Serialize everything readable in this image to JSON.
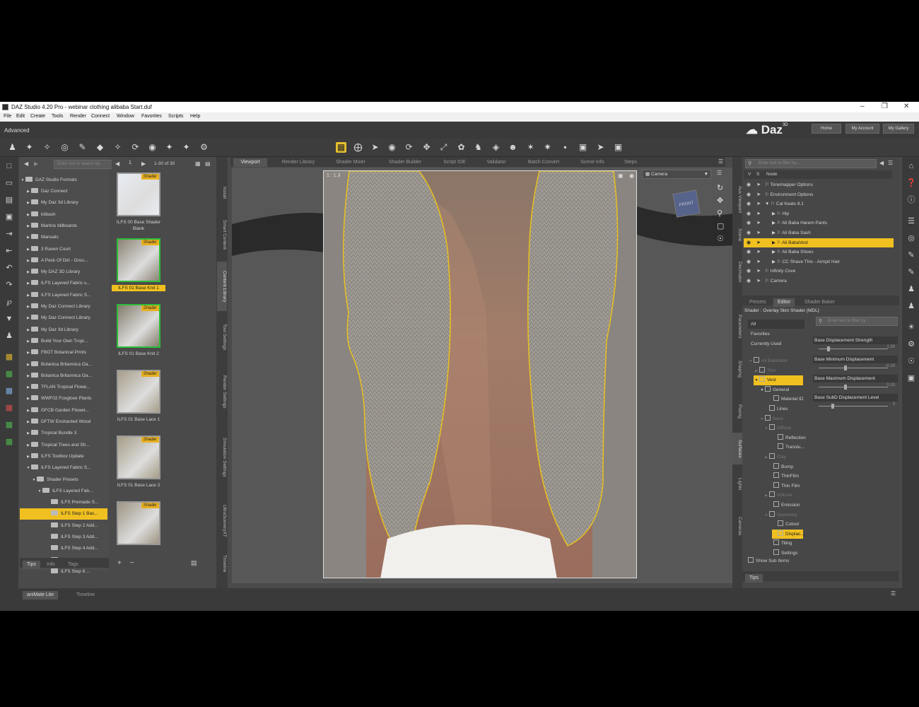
{
  "window": {
    "title": "DAZ Studio 4.20 Pro - webinar clothing alibaba Start.duf"
  },
  "menu": [
    "File",
    "Edit",
    "Create",
    "Tools",
    "Render",
    "Connect",
    "Window",
    "Favorites",
    "Scripts",
    "Help"
  ],
  "layout_label": "Advanced",
  "brand": {
    "logo": "Daz",
    "sup": "3D"
  },
  "nav_buttons": [
    "Home",
    "My Account",
    "My Gallery"
  ],
  "library": {
    "search_placeholder": "Enter text to search by...",
    "root": "DAZ Studio Formats",
    "items": [
      "Daz Connect",
      "My Daz 3d Library",
      "kitbash",
      "Martins billboards",
      "Manuals",
      "3 Raven Court",
      "A Peck Of Dirt - Grou...",
      "My DAZ 3D Library",
      "ILFS Layered Fabric s...",
      "ILFS Layered Fabric S...",
      "My Daz Connect Library",
      "My Daz Connect Library",
      "My Daz 3d Library",
      "Build Your Own Tropi...",
      "FBOT Botanical Prints",
      "Botanica Britannica Oa...",
      "Botanica Britannica Oa...",
      "TFLAN Tropical Flowe...",
      "WWF02 Foxglove Plants",
      "GFCB Garden Flower...",
      "DFTW Enchanted Wood",
      "Tropical Bundle 3",
      "Tropical Trees and Sh...",
      "ILFS Toolbox Update",
      "ILFS Layered Fabric S..."
    ],
    "sub_items": [
      "Shader Presets",
      "ILFS Layered Fab...",
      "ILFS Premade S...",
      "ILFS Step 1 Bas...",
      "ILFS Step 2 Add...",
      "ILFS Step 3 Add...",
      "ILFS Step 4 Add...",
      "ILFS Step 5 Add...",
      "ILFS Step 6 ..."
    ],
    "tabs": [
      "Tips",
      "Info",
      "Tags"
    ]
  },
  "thumbs": {
    "page_number": "1",
    "range": "1-30 of 30",
    "badge": "Shader",
    "items": [
      {
        "label": "ILFS 00 Base Shader Blank"
      },
      {
        "label": "ILFS 01 Base Knit 1"
      },
      {
        "label": "ILFS 01 Base Knit 2"
      },
      {
        "label": "ILFS 01 Base Lace 1"
      },
      {
        "label": "ILFS 01 Base Lace 2"
      },
      {
        "label": ""
      }
    ]
  },
  "side_tabs_left": [
    "Install",
    "Smart Content",
    "Content Library",
    "Tool Settings",
    "Render Settings",
    "Simulation Settings",
    "UltraSceneryXT",
    "Timeline"
  ],
  "viewport": {
    "tabs": [
      "Viewport",
      "Render Library",
      "Shader Mixer",
      "Shader Builder",
      "Script IDE",
      "Validator",
      "Batch Convert",
      "Scene Info",
      "Steps"
    ],
    "ratio": "1 : 1.3",
    "camera": "Camera",
    "cube_label": "FRONT"
  },
  "side_tabs_mid": [
    "Aux Viewport",
    "Scene",
    "Decimator",
    "Parameters",
    "Shaping",
    "Posing",
    "Surfaces",
    "Lights",
    "Cameras"
  ],
  "scene": {
    "filter_placeholder": "Enter text to filter by...",
    "col_v": "V",
    "col_s": "S",
    "col_node": "Node",
    "rows": [
      "Tonemapper Options",
      "Environment Options",
      "Cal Keats 8.1",
      "Hip",
      "Ali Baba Harem Pants",
      "Ali Baba Sash",
      "Ali BabaVest",
      "Ali Baba Shoes",
      "CC Shave This - Armpit Hair",
      "Infinity Cove",
      "Camera"
    ]
  },
  "surfaces": {
    "tabs": [
      "Presets",
      "Editor",
      "Shader Baker"
    ],
    "shader": "Shader : Overlay Skin Shader (MDL)",
    "filters": [
      "All",
      "Favorites",
      "Currently Used"
    ],
    "filter_placeholder": "Enter text to filter by...",
    "tree": [
      "Ali BabaVest",
      "Trim",
      "Vest",
      "General",
      "Material ID",
      "Lines",
      "Base",
      "Diffuse",
      "Reflection",
      "Translu...",
      "Clay",
      "Bump",
      "ThinFilm",
      "Thin Film",
      "Volume",
      "Emission",
      "Geometry",
      "Cutout",
      "Displac...",
      "Tiling",
      "Settings"
    ],
    "show_sub_items": "Show Sub Items",
    "params": [
      {
        "label": "Base Displacement Strength",
        "value": "1.00"
      },
      {
        "label": "Base Minimum Displacement",
        "value": "-0.10"
      },
      {
        "label": "Base Maximum Displacement",
        "value": "0.10"
      },
      {
        "label": "Base SubD Displacement Level",
        "value": "3"
      }
    ],
    "bottom_tab": "Tips"
  },
  "bottom_tabs": [
    "aniMate Lite",
    "Timeline"
  ]
}
